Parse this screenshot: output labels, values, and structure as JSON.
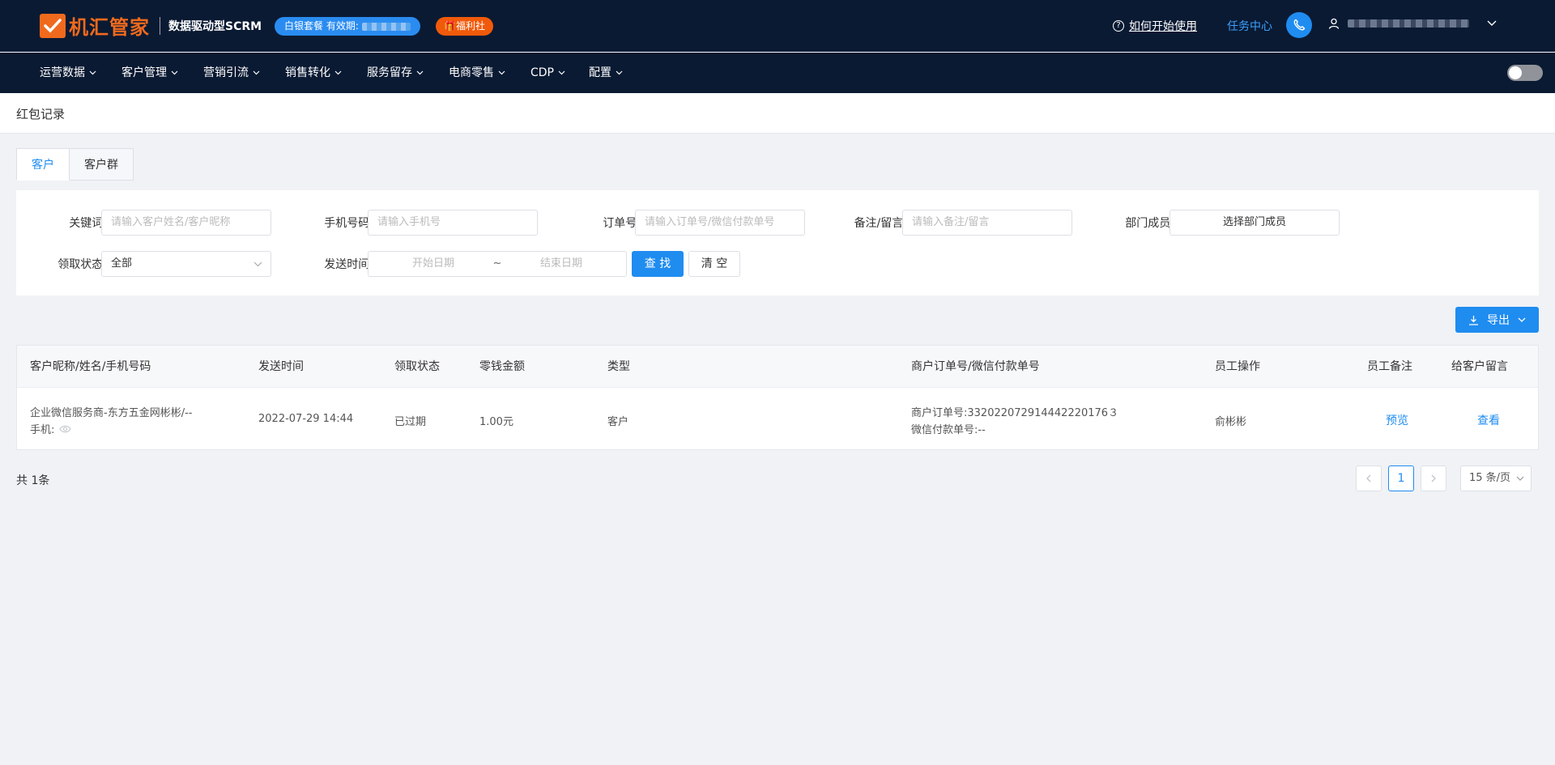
{
  "header": {
    "brand_name": "机汇管家",
    "brand_sub": "数据驱动型SCRM",
    "plan_badge": "白银套餐 有效期:",
    "welfare_badge": "福利社",
    "help_link": "如何开始使用",
    "task_center": "任务中心"
  },
  "nav": {
    "items": [
      {
        "label": "运营数据"
      },
      {
        "label": "客户管理"
      },
      {
        "label": "营销引流"
      },
      {
        "label": "销售转化"
      },
      {
        "label": "服务留存"
      },
      {
        "label": "电商零售"
      },
      {
        "label": "CDP"
      },
      {
        "label": "配置"
      }
    ]
  },
  "page": {
    "title": "红包记录"
  },
  "tabs": [
    {
      "label": "客户",
      "active": true
    },
    {
      "label": "客户群",
      "active": false
    }
  ],
  "filters": {
    "keyword_label": "关键词:",
    "keyword_placeholder": "请输入客户姓名/客户昵称",
    "phone_label": "手机号码:",
    "phone_placeholder": "请输入手机号",
    "order_label": "订单号:",
    "order_placeholder": "请输入订单号/微信付款单号",
    "remark_label": "备注/留言:",
    "remark_placeholder": "请输入备注/留言",
    "dept_label": "部门成员:",
    "dept_button": "选择部门成员",
    "status_label": "领取状态:",
    "status_value": "全部",
    "send_time_label": "发送时间:",
    "start_placeholder": "开始日期",
    "range_sep": "~",
    "end_placeholder": "结束日期",
    "search_button": "查 找",
    "clear_button": "清 空"
  },
  "toolbar": {
    "export_label": "导出"
  },
  "table": {
    "columns": [
      "客户昵称/姓名/手机号码",
      "发送时间",
      "领取状态",
      "零钱金额",
      "类型",
      "商户订单号/微信付款单号",
      "员工操作",
      "员工备注",
      "给客户留言"
    ],
    "rows": [
      {
        "customer_line1": "企业微信服务商-东方五金网彬彬/--",
        "customer_line2": "手机:",
        "send_time": "2022-07-29 14:44",
        "status": "已过期",
        "amount": "1.00元",
        "type": "客户",
        "merchant_order": "商户订单号:332022072914442220176３",
        "wechat_order": "微信付款单号:--",
        "staff": "俞彬彬",
        "remark_action": "预览",
        "message_action": "查看"
      }
    ]
  },
  "pagination": {
    "total": "共 1条",
    "current_page": "1",
    "page_size": "15 条/页"
  }
}
